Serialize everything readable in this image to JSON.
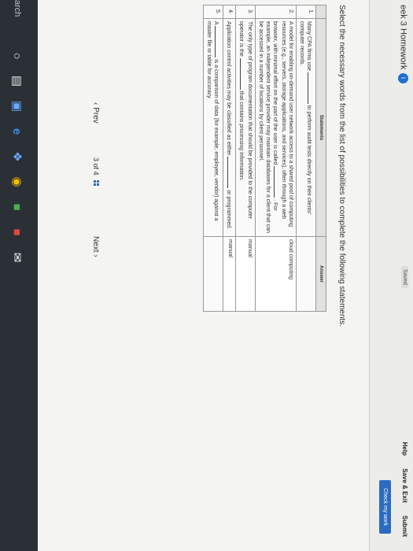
{
  "header": {
    "title": "eek 3 Homework",
    "info_badge": "i",
    "saved": "Saved",
    "help": "Help",
    "save_exit": "Save & Exit",
    "submit": "Submit",
    "check_work": "Check my work"
  },
  "instruction": "Select the necessary words from the list of possibilities to complete the following statements.",
  "table": {
    "headers": {
      "statements": "Statements",
      "answer": "Answer"
    },
    "rows": [
      {
        "num": "1.",
        "pre": "Many CPA firms use",
        "post": "to perform audit tests directly on their clients' computer records.",
        "answer": ""
      },
      {
        "num": "2.",
        "pre": "A model for enabling on-demand user network access to a shared pool of computing resources (e.g., servers, storage applications, and services), often through a web browser, with minimal effort on the part of the user is called",
        "post": ". For example, an independent service provider may maintain databases for a client that can be accessed in a number of locations by client personnel.",
        "answer": "cloud computing"
      },
      {
        "num": "3.",
        "pre": "The only type of program documentation that should be provided to the computer operator is the",
        "post": "that contains processing information.",
        "answer": "manual"
      },
      {
        "num": "4.",
        "pre": "Application control activities may be classified as either",
        "post": "or programmed.",
        "answer": "manual"
      },
      {
        "num": "5.",
        "pre": "A",
        "post": "is a comparison of data (for example, employee, vendor) against a master file or table for accuracy.",
        "answer": ""
      }
    ]
  },
  "pager": {
    "prev": "Prev",
    "current": "3",
    "of": "of",
    "total": "4",
    "next": "Next"
  },
  "taskbar": {
    "search": "arch"
  }
}
